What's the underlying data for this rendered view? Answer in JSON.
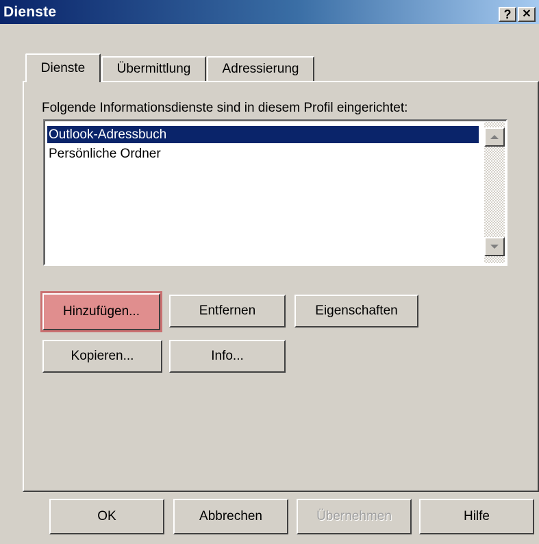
{
  "window": {
    "title": "Dienste",
    "help_glyph": "?",
    "close_glyph": "✕"
  },
  "tabs": [
    {
      "label": "Dienste",
      "active": true
    },
    {
      "label": "Übermittlung",
      "active": false
    },
    {
      "label": "Adressierung",
      "active": false
    }
  ],
  "services": {
    "prompt": "Folgende Informationsdienste sind in diesem Profil eingerichtet:",
    "items": [
      {
        "label": "Outlook-Adressbuch",
        "selected": true
      },
      {
        "label": "Persönliche Ordner",
        "selected": false
      }
    ]
  },
  "actions": {
    "add": "Hinzufügen...",
    "remove": "Entfernen",
    "properties": "Eigenschaften",
    "copy": "Kopieren...",
    "info": "Info..."
  },
  "footer": {
    "ok": "OK",
    "cancel": "Abbrechen",
    "apply": "Übernehmen",
    "help": "Hilfe"
  },
  "colors": {
    "face": "#d4d0c8",
    "title_start": "#0a246a",
    "title_end": "#a6caf0",
    "selection": "#0a246a",
    "highlight": "#e08e8e"
  }
}
